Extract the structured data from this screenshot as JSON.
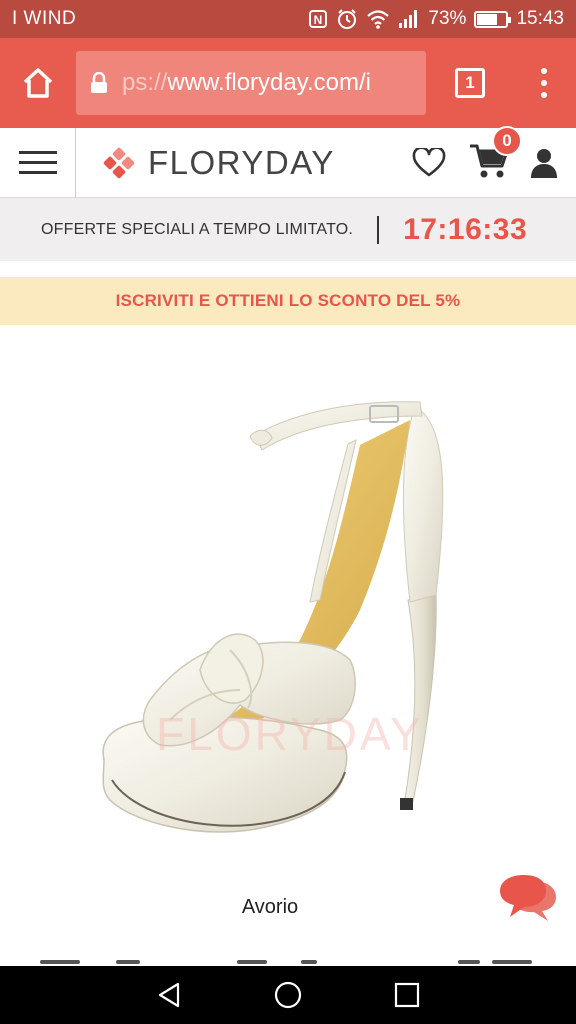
{
  "status_bar": {
    "carrier": "I WIND",
    "battery_percent": "73%",
    "battery_level": 0.73,
    "time": "15:43",
    "icons": [
      "nfc-icon",
      "alarm-icon",
      "wifi-icon",
      "signal-icon",
      "battery-icon"
    ]
  },
  "browser": {
    "url_scheme": "ps://",
    "url_host": "www.floryday.com/i",
    "tab_count": "1",
    "icons": [
      "home-icon",
      "lock-icon",
      "tabs-icon",
      "overflow-menu-icon"
    ]
  },
  "site_header": {
    "brand": "FLORYDAY",
    "cart_count": "0",
    "icons": [
      "hamburger-menu-icon",
      "floryday-logo-icon",
      "heart-icon",
      "cart-icon",
      "user-icon"
    ]
  },
  "promo": {
    "offer_text": "OFFERTE SPECIALI A TEMPO LIMITATO.",
    "timer": "17:16:33"
  },
  "subscribe_banner": {
    "text": "ISCRIVITI E OTTIENI LO SCONTO DEL 5%"
  },
  "product": {
    "image_name": "ivory-platform-sandal",
    "watermark": "FLORYDAY",
    "color_label": "Avorio"
  },
  "colors": {
    "status_bar": "#b94a40",
    "browser_bar": "#e85c50",
    "accent": "#e8554a",
    "subscribe_bg": "#fbe9c0",
    "promo_bg": "#f0eeee"
  },
  "nav_bar": {
    "icons": [
      "back-icon",
      "home-circle-icon",
      "recents-icon"
    ]
  }
}
